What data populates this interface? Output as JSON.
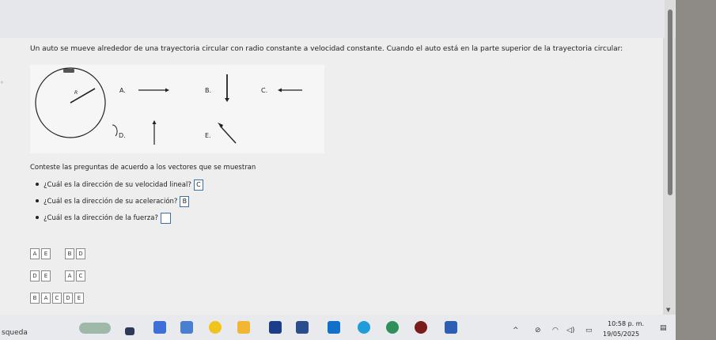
{
  "question": {
    "text": "Un auto se mueve alrededor de una trayectoria circular con radio constante a velocidad constante. Cuando el auto está en la parte superior de la trayectoria circular:"
  },
  "diagram": {
    "radius_label": "R",
    "options": [
      "A.",
      "B.",
      "C.",
      "D.",
      "E."
    ]
  },
  "instructions": "Conteste las preguntas de acuerdo a los vectores que se muestran",
  "questions": [
    {
      "text": "¿Cuál es la dirección de su velocidad lineal?",
      "answer": "C"
    },
    {
      "text": "¿Cuál es la dirección de su aceleración?",
      "answer": "B"
    },
    {
      "text": "¿Cuál es la dirección de la fuerza?",
      "answer": ""
    }
  ],
  "tile_rows": [
    [
      [
        "A",
        "E"
      ],
      [
        "B",
        "D"
      ]
    ],
    [
      [
        "D",
        "E"
      ],
      [
        "A",
        "C"
      ]
    ],
    [
      [
        "B",
        "A",
        "C",
        "D",
        "E"
      ]
    ]
  ],
  "taskbar": {
    "search_label": "squeda",
    "time": "10:58 p. m.",
    "date": "19/05/2025"
  }
}
